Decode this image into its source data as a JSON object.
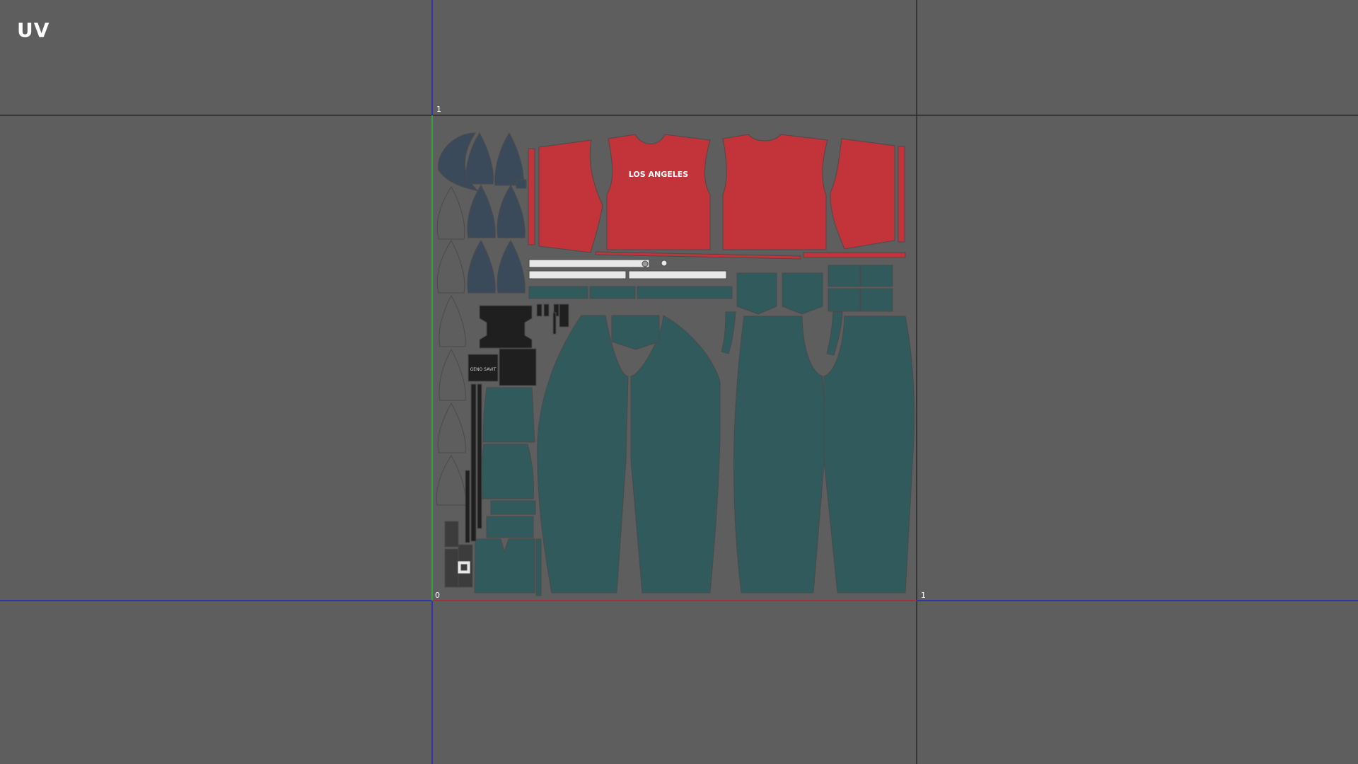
{
  "editor": {
    "title": "UV"
  },
  "axis_labels": {
    "u_one": "1",
    "v_one": "1",
    "origin": "0"
  },
  "layout_print": {
    "text": "LOS ANGELES"
  },
  "small_print": {
    "text": "GENO SAVIT"
  },
  "colors": {
    "background": "#5e5e5e",
    "grid_line": "#2a2a2a",
    "u_axis": "#2424c8",
    "v_axis": "#2bb52b",
    "origin_edge": "#c82828",
    "shirt": "#c2343a",
    "pants": "#305a5b",
    "cap": "#3a4a5a",
    "strap": "#1f1f1f",
    "band": "#e8e8e8",
    "outline": "#4a4a4a"
  }
}
